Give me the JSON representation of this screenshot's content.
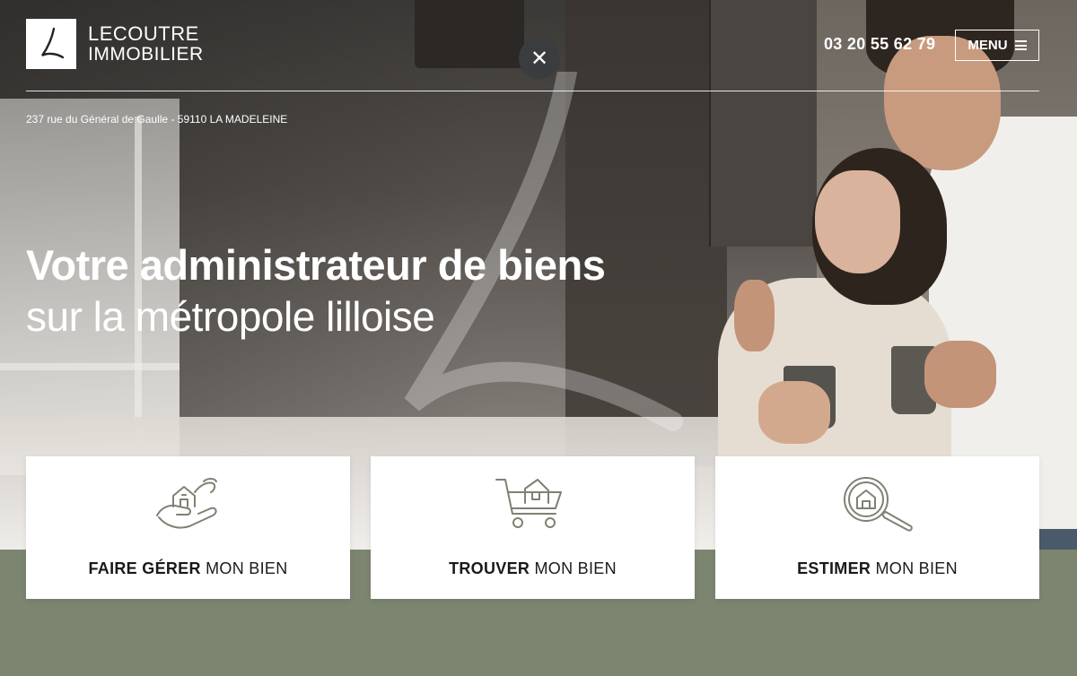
{
  "header": {
    "logo_line1": "LECOUTRE",
    "logo_line2": "IMMOBILIER",
    "logo_icon": "l-monogram-icon",
    "phone": "03 20 55 62 79",
    "menu_label": "MENU",
    "address": "237 rue du Général de Gaulle - 59110 LA MADELEINE"
  },
  "close_icon": "close-icon",
  "hero": {
    "title_bold": "Votre administrateur de biens",
    "title_light": "sur la métropole lilloise"
  },
  "cards": [
    {
      "bold": "FAIRE GÉRER",
      "rest": " MON BIEN",
      "icon": "hand-house-icon"
    },
    {
      "bold": "TROUVER",
      "rest": " MON BIEN",
      "icon": "cart-house-icon"
    },
    {
      "bold": "ESTIMER",
      "rest": " MON BIEN",
      "icon": "magnifier-house-icon"
    }
  ],
  "colors": {
    "accent_green": "#7b8570",
    "icon_stroke": "#7d8272",
    "text_dark": "#1a1a1a"
  }
}
